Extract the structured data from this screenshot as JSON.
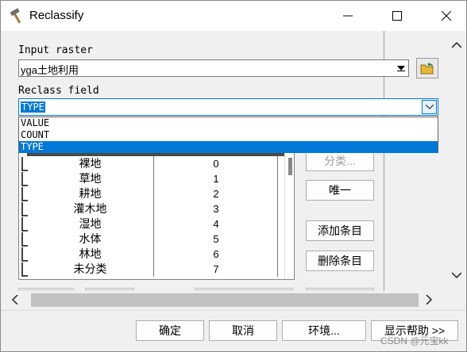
{
  "window": {
    "title": "Reclassify"
  },
  "input_raster": {
    "label": "Input raster",
    "value": "yga土地利用"
  },
  "reclass_field": {
    "label": "Reclass field",
    "value": "TYPE",
    "options": [
      "VALUE",
      "COUNT",
      "TYPE"
    ],
    "selected_index": 2
  },
  "table": {
    "rows": [
      {
        "old": "裸地",
        "new": "0"
      },
      {
        "old": "草地",
        "new": "1"
      },
      {
        "old": "耕地",
        "new": "2"
      },
      {
        "old": "灌木地",
        "new": "3"
      },
      {
        "old": "湿地",
        "new": "4"
      },
      {
        "old": "水体",
        "new": "5"
      },
      {
        "old": "林地",
        "new": "6"
      },
      {
        "old": "未分类",
        "new": "7"
      }
    ]
  },
  "side_buttons": {
    "classify": "分类...",
    "unique": "唯一",
    "add_entry": "添加条目",
    "delete_entry": "删除条目"
  },
  "footer": {
    "ok": "确定",
    "cancel": "取消",
    "environments": "环境...",
    "show_help": "显示帮助 >>"
  },
  "watermark": "CSDN @元宝kk",
  "colors": {
    "accent": "#0078d7"
  }
}
